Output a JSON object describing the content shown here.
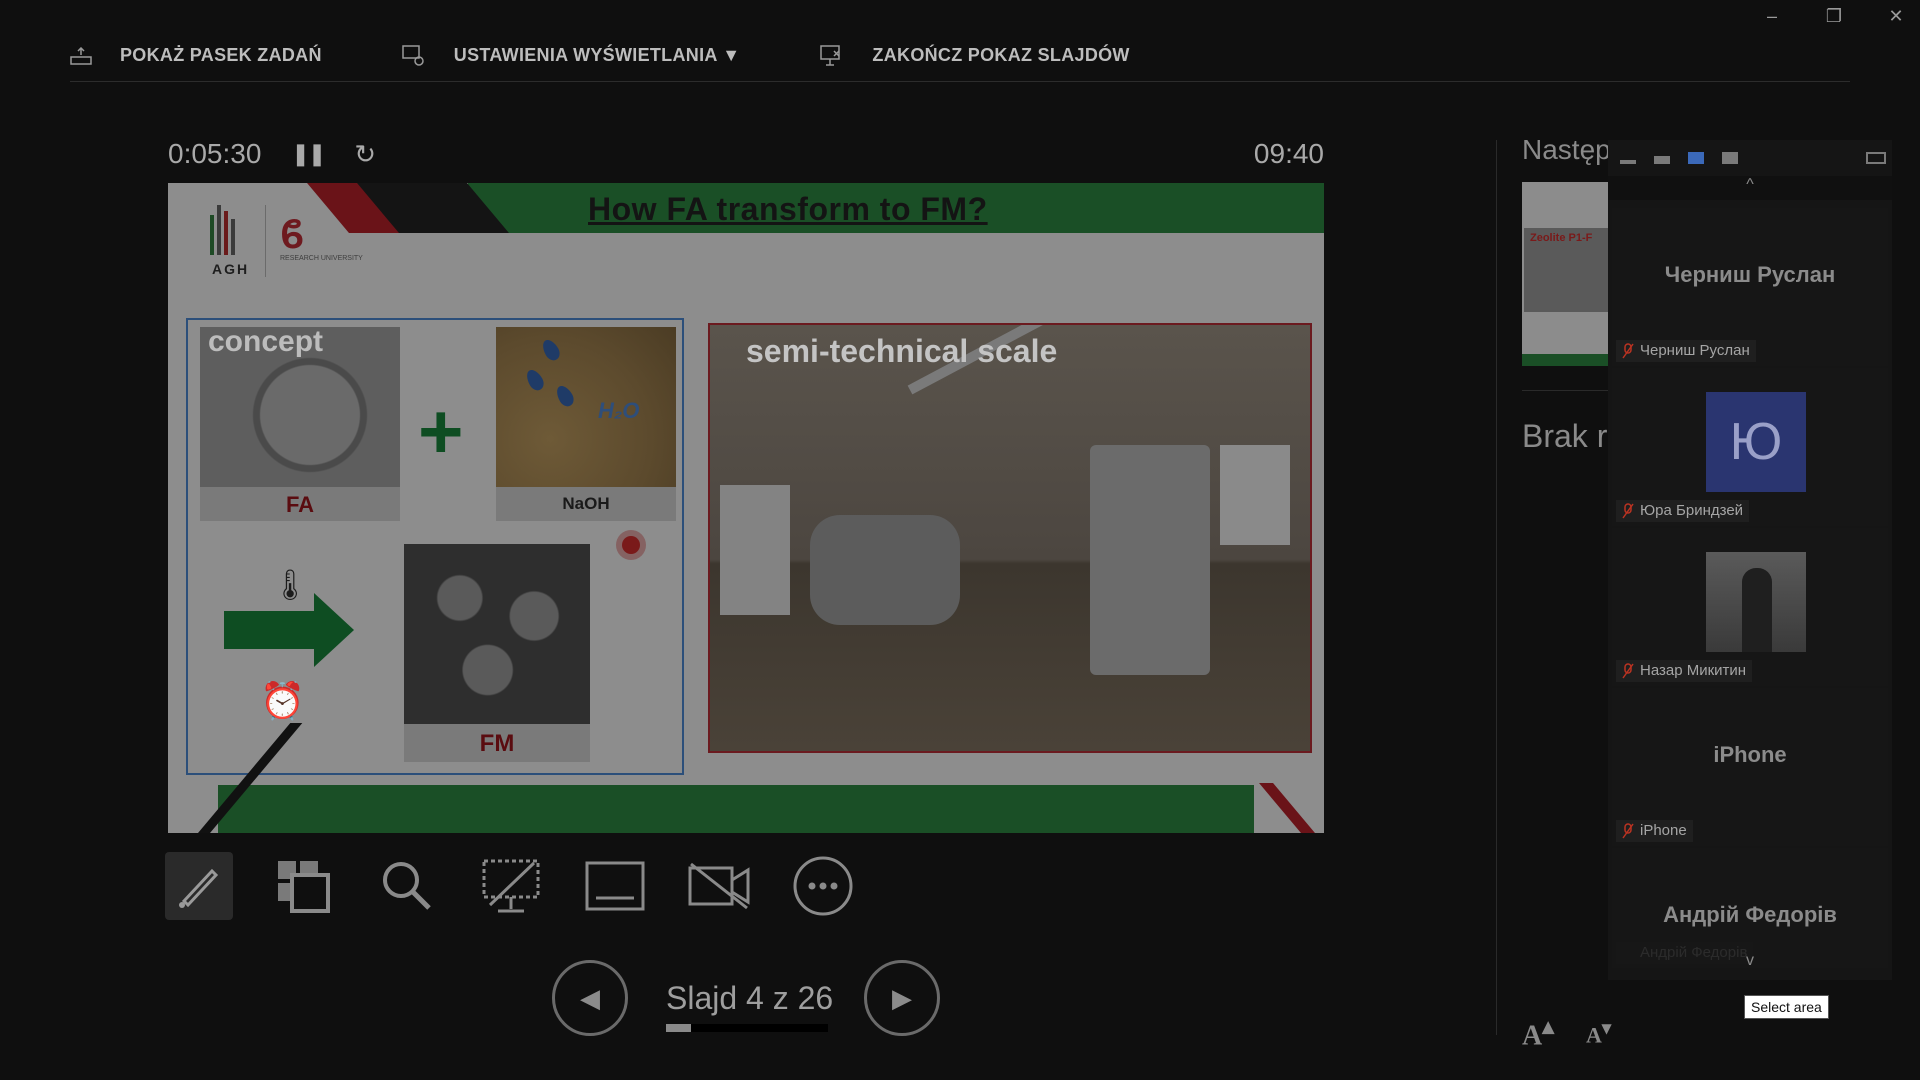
{
  "window": {
    "minimize": "–",
    "restore": "❐",
    "close": "✕"
  },
  "toolbar": {
    "taskbar_label": "POKAŻ PASEK ZADAŃ",
    "display_label": "USTAWIENIA WYŚWIETLANIA ▼",
    "end_label": "ZAKOŃCZ POKAZ SLAJDÓW"
  },
  "timer": {
    "elapsed": "0:05:30",
    "clock": "09:40",
    "pause_glyph": "❚❚",
    "reset_glyph": "↻"
  },
  "slide": {
    "title": "How FA transform to FM?",
    "logo_text": "AGH",
    "logo_ru_text": "RESEARCH UNIVERSITY",
    "concept_label": "concept",
    "fa_label": "FA",
    "naoh_label": "NaOH",
    "h2o_label": "H₂O",
    "fm_label": "FM",
    "semi_label": "semi-technical scale"
  },
  "tools": [
    {
      "name": "pen-tool",
      "active": true
    },
    {
      "name": "all-slides-tool"
    },
    {
      "name": "zoom-tool"
    },
    {
      "name": "black-screen-tool"
    },
    {
      "name": "subtitles-tool"
    },
    {
      "name": "camera-tool"
    },
    {
      "name": "more-options-tool"
    }
  ],
  "navigation": {
    "slide_label": "Slajd 4 z 26",
    "current": 4,
    "total": 26,
    "prev_glyph": "◀",
    "next_glyph": "▶"
  },
  "presenter": {
    "next_label": "Następ",
    "next_thumb_text": "Zeolite P1-F",
    "notes_label": "Brak r",
    "font_up": "A",
    "font_down": "A"
  },
  "participants": {
    "chev_up": "^",
    "chev_down": "v",
    "tiles": [
      {
        "big": "Черниш Руслан",
        "name": "Черниш Руслан"
      },
      {
        "avatar": "Ю",
        "name": "Юра Бриндзей"
      },
      {
        "name": "Назар Микитин"
      },
      {
        "big": "iPhone",
        "name": "iPhone"
      },
      {
        "big": "Андрій Федорів",
        "name": "Андрій Федорів"
      }
    ]
  },
  "tooltip": "Select area",
  "colors": {
    "accent_blue": "#3b69b9",
    "slide_green": "#1a4f26",
    "slide_red": "#6a1318"
  }
}
